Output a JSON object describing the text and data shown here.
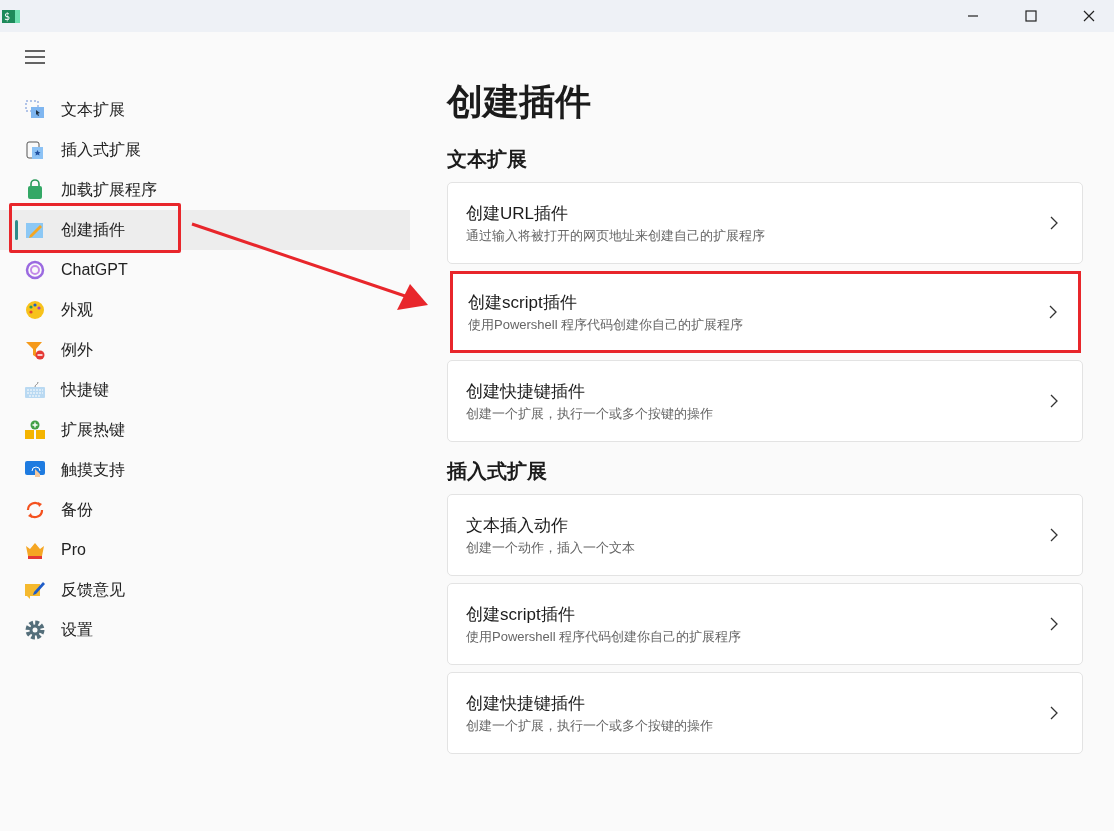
{
  "window": {
    "icon_glyph": "$"
  },
  "sidebar": {
    "items": [
      {
        "label": "文本扩展",
        "selected": false,
        "highlighted": false
      },
      {
        "label": "插入式扩展",
        "selected": false,
        "highlighted": false
      },
      {
        "label": "加载扩展程序",
        "selected": false,
        "highlighted": false
      },
      {
        "label": "创建插件",
        "selected": true,
        "highlighted": true
      },
      {
        "label": "ChatGPT",
        "selected": false,
        "highlighted": false
      },
      {
        "label": "外观",
        "selected": false,
        "highlighted": false
      },
      {
        "label": "例外",
        "selected": false,
        "highlighted": false
      },
      {
        "label": "快捷键",
        "selected": false,
        "highlighted": false
      },
      {
        "label": "扩展热键",
        "selected": false,
        "highlighted": false
      },
      {
        "label": "触摸支持",
        "selected": false,
        "highlighted": false
      },
      {
        "label": "备份",
        "selected": false,
        "highlighted": false
      },
      {
        "label": "Pro",
        "selected": false,
        "highlighted": false
      },
      {
        "label": "反馈意见",
        "selected": false,
        "highlighted": false
      },
      {
        "label": "设置",
        "selected": false,
        "highlighted": false
      }
    ]
  },
  "page": {
    "title": "创建插件",
    "sections": [
      {
        "heading": "文本扩展",
        "cards": [
          {
            "title": "创建URL插件",
            "subtitle": "通过输入将被打开的网页地址来创建自己的扩展程序",
            "highlighted": false
          },
          {
            "title": "创建script插件",
            "subtitle": "使用Powershell 程序代码创建你自己的扩展程序",
            "highlighted": true
          },
          {
            "title": "创建快捷键插件",
            "subtitle": "创建一个扩展，执行一个或多个按键的操作",
            "highlighted": false
          }
        ]
      },
      {
        "heading": "插入式扩展",
        "cards": [
          {
            "title": "文本插入动作",
            "subtitle": "创建一个动作，插入一个文本",
            "highlighted": false
          },
          {
            "title": "创建script插件",
            "subtitle": "使用Powershell 程序代码创建你自己的扩展程序",
            "highlighted": false
          },
          {
            "title": "创建快捷键插件",
            "subtitle": "创建一个扩展，执行一个或多个按键的操作",
            "highlighted": false
          }
        ]
      }
    ]
  },
  "annotation": {
    "arrow": true
  }
}
